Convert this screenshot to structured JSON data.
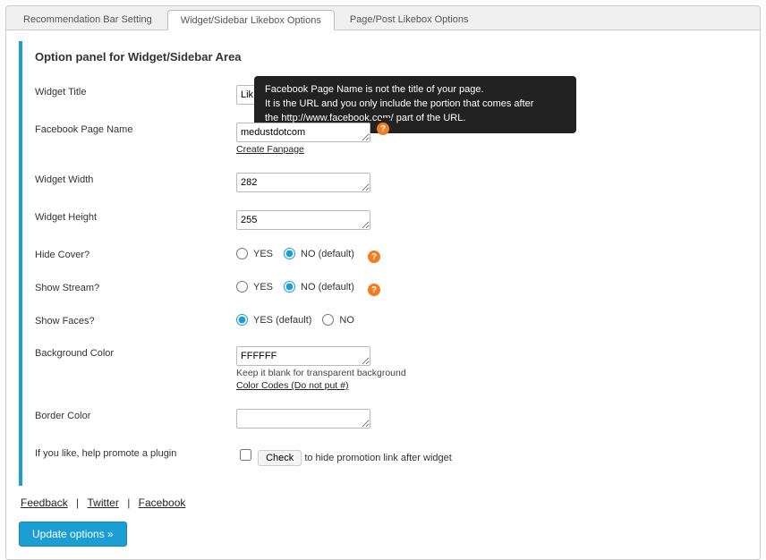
{
  "tabs": {
    "rec": "Recommendation Bar Setting",
    "widget": "Widget/Sidebar Likebox Options",
    "page": "Page/Post Likebox Options"
  },
  "panel": {
    "title": "Option panel for Widget/Sidebar Area"
  },
  "labels": {
    "widget_title": "Widget Title",
    "fb_page_name": "Facebook Page Name",
    "widget_width": "Widget Width",
    "widget_height": "Widget Height",
    "hide_cover": "Hide Cover?",
    "show_stream": "Show Stream?",
    "show_faces": "Show Faces?",
    "bg_color": "Background Color",
    "border_color": "Border Color",
    "promote": "If you like, help promote a plugin"
  },
  "values": {
    "widget_title": "Lik",
    "fb_page_name": "medustdotcom",
    "widget_width": "282",
    "widget_height": "255",
    "bg_color": "FFFFFF",
    "border_color": ""
  },
  "radios": {
    "yes": "YES",
    "no": "NO",
    "no_default": "NO (default)",
    "yes_default": "YES (default)"
  },
  "hints": {
    "create_fanpage": "Create Fanpage",
    "bg_hint": "Keep it blank for transparent background",
    "color_codes": "Color Codes (Do not put #)"
  },
  "tooltip": {
    "line1": "Facebook Page Name is not the title of your page.",
    "line2": "It is the URL and you only include the portion that comes after",
    "line3": "the http://www.facebook.com/ part of the URL."
  },
  "promo": {
    "check_btn": "Check",
    "text": "to hide promotion link after widget"
  },
  "footer": {
    "feedback": "Feedback",
    "twitter": "Twitter",
    "facebook": "Facebook"
  },
  "buttons": {
    "update": "Update options »"
  },
  "icons": {
    "help": "?"
  }
}
